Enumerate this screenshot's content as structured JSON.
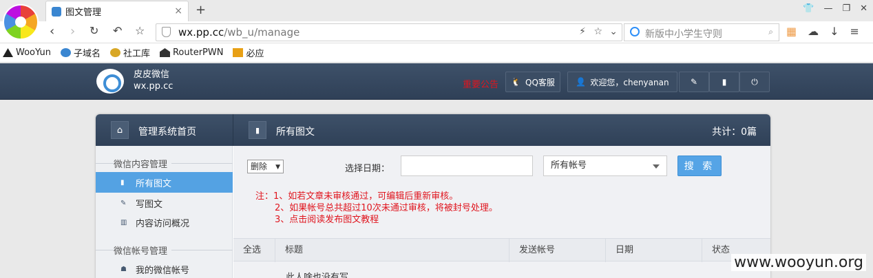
{
  "browser": {
    "tab_title": "图文管理",
    "tab_close": "×",
    "new_tab": "+",
    "url_domain": "wx.pp.cc",
    "url_path": "/wb_u/manage",
    "search_placeholder": "新版中小学生守则",
    "bookmarks": [
      "WooYun",
      "子域名",
      "社工库",
      "RouterPWN",
      "必应"
    ]
  },
  "site": {
    "name": "皮皮微信",
    "domain": "wx.pp.cc",
    "notice": "重要公告",
    "qq_service": "QQ客服",
    "welcome": "欢迎您，chenyanan"
  },
  "panel": {
    "home_title": "管理系统首页",
    "page_title": "所有图文",
    "total": "共计：0篇"
  },
  "sidebar": {
    "group1": "微信内容管理",
    "group2": "微信帐号管理",
    "items": [
      {
        "label": "所有图文"
      },
      {
        "label": "写图文"
      },
      {
        "label": "内容访问概况"
      },
      {
        "label": "我的微信帐号"
      }
    ]
  },
  "filter": {
    "action_select": "删除",
    "date_label": "选择日期：",
    "date_value": "",
    "account_select": "所有帐号",
    "search_button": "搜 索"
  },
  "notes": [
    "注：1、如若文章未审核通过，可编辑后重新审核。",
    "2、如果帐号总共超过10次未通过审核，将被封号处理。",
    "3、点击阅读发布图文教程"
  ],
  "table": {
    "headers": [
      "全选",
      "标题",
      "发送帐号",
      "日期",
      "状态"
    ],
    "empty_text": "此人啥也没有写"
  },
  "watermark": "www.wooyun.org"
}
